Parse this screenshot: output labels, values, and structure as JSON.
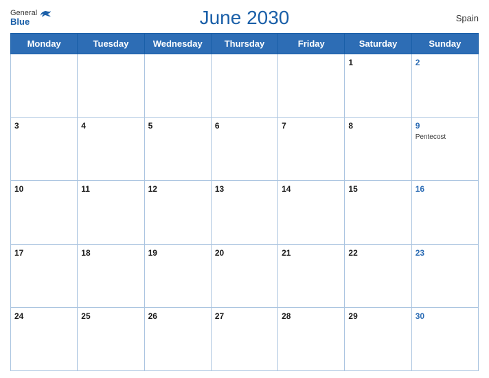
{
  "header": {
    "title": "June 2030",
    "country": "Spain",
    "logo_general": "General",
    "logo_blue": "Blue"
  },
  "weekdays": [
    "Monday",
    "Tuesday",
    "Wednesday",
    "Thursday",
    "Friday",
    "Saturday",
    "Sunday"
  ],
  "weeks": [
    [
      {
        "day": "",
        "events": []
      },
      {
        "day": "",
        "events": []
      },
      {
        "day": "",
        "events": []
      },
      {
        "day": "",
        "events": []
      },
      {
        "day": "",
        "events": []
      },
      {
        "day": "1",
        "events": []
      },
      {
        "day": "2",
        "events": [],
        "isSunday": true
      }
    ],
    [
      {
        "day": "3",
        "events": []
      },
      {
        "day": "4",
        "events": []
      },
      {
        "day": "5",
        "events": []
      },
      {
        "day": "6",
        "events": []
      },
      {
        "day": "7",
        "events": []
      },
      {
        "day": "8",
        "events": []
      },
      {
        "day": "9",
        "events": [
          {
            "text": "Pentecost"
          }
        ],
        "isSunday": true
      }
    ],
    [
      {
        "day": "10",
        "events": []
      },
      {
        "day": "11",
        "events": []
      },
      {
        "day": "12",
        "events": []
      },
      {
        "day": "13",
        "events": []
      },
      {
        "day": "14",
        "events": []
      },
      {
        "day": "15",
        "events": []
      },
      {
        "day": "16",
        "events": [],
        "isSunday": true
      }
    ],
    [
      {
        "day": "17",
        "events": []
      },
      {
        "day": "18",
        "events": []
      },
      {
        "day": "19",
        "events": []
      },
      {
        "day": "20",
        "events": []
      },
      {
        "day": "21",
        "events": []
      },
      {
        "day": "22",
        "events": []
      },
      {
        "day": "23",
        "events": [],
        "isSunday": true
      }
    ],
    [
      {
        "day": "24",
        "events": []
      },
      {
        "day": "25",
        "events": []
      },
      {
        "day": "26",
        "events": []
      },
      {
        "day": "27",
        "events": []
      },
      {
        "day": "28",
        "events": []
      },
      {
        "day": "29",
        "events": []
      },
      {
        "day": "30",
        "events": [],
        "isSunday": true
      }
    ]
  ]
}
